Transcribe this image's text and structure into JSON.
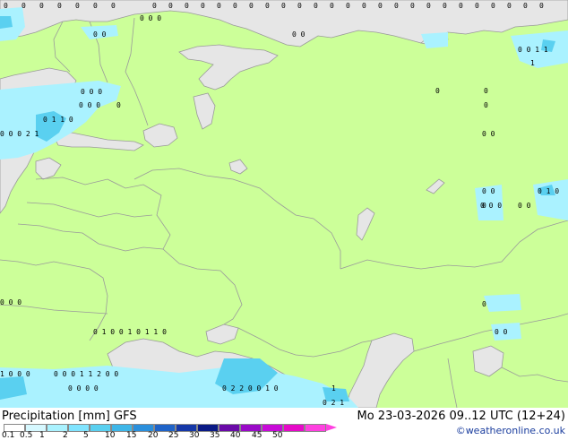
{
  "map": {
    "colors": {
      "land": "#ccff99",
      "sea": "#e6e6e6",
      "border": "#9a9a9a",
      "precip_light": "#aaf2ff",
      "precip_medium": "#5ad0f0"
    },
    "zero_rows": [
      [
        "0",
        "0",
        "0",
        "0",
        "0",
        "0",
        "0"
      ],
      [
        "0",
        "0",
        "0",
        "0",
        "0",
        "0",
        "0",
        "0",
        "0",
        "0",
        "0",
        "0",
        "0",
        "0",
        "0",
        "0",
        "0",
        "0",
        "0",
        "0",
        "0",
        "0",
        "0",
        "0",
        "0"
      ]
    ],
    "precip_labels": [
      {
        "t": "0 0"
      },
      {
        "t": "0 0 0"
      },
      {
        "t": "0 0"
      },
      {
        "t": "0 0 1 1"
      },
      {
        "t": "1"
      },
      {
        "t": "0 0 0"
      },
      {
        "t": "0"
      },
      {
        "t": "0 0 0"
      },
      {
        "t": "0 1 1 0"
      },
      {
        "t": "0 0 0 2 1"
      },
      {
        "t": "0"
      },
      {
        "t": "0"
      },
      {
        "t": "0"
      },
      {
        "t": "0 0"
      },
      {
        "t": "0 0"
      },
      {
        "t": "0"
      },
      {
        "t": "0 0 0"
      },
      {
        "t": "0 0"
      },
      {
        "t": "0 1 0"
      },
      {
        "t": "0 0 0"
      },
      {
        "t": "0"
      },
      {
        "t": "0 0"
      },
      {
        "t": "0 1 0 0 1 0 1 1 0"
      },
      {
        "t": "0 0 0 1 1 2 0 0"
      },
      {
        "t": "0 0 0 0"
      },
      {
        "t": "0 2 2 0 0 1 0"
      },
      {
        "t": "1 0 0 0"
      },
      {
        "t": "1"
      },
      {
        "t": "0 2 1"
      }
    ]
  },
  "footer": {
    "title": "Precipitation [mm]  GFS",
    "datetime": "Mo 23-03-2026 09..12 UTC (12+24)",
    "credit": "©weatheronline.co.uk",
    "legend": {
      "ticks": [
        "0.1",
        "0.5",
        "1",
        "2",
        "5",
        "10",
        "15",
        "20",
        "25",
        "30",
        "35",
        "40",
        "45",
        "50"
      ],
      "colors": [
        "#ffffff",
        "#d6f8ff",
        "#aaf2ff",
        "#80e4ff",
        "#5ad0f0",
        "#3eb6e8",
        "#2a8fdc",
        "#1f63c8",
        "#1538a8",
        "#0a1a86",
        "#6a0aa8",
        "#9a0ac8",
        "#c80ad8",
        "#e60ac8",
        "#ff40e0"
      ]
    }
  }
}
